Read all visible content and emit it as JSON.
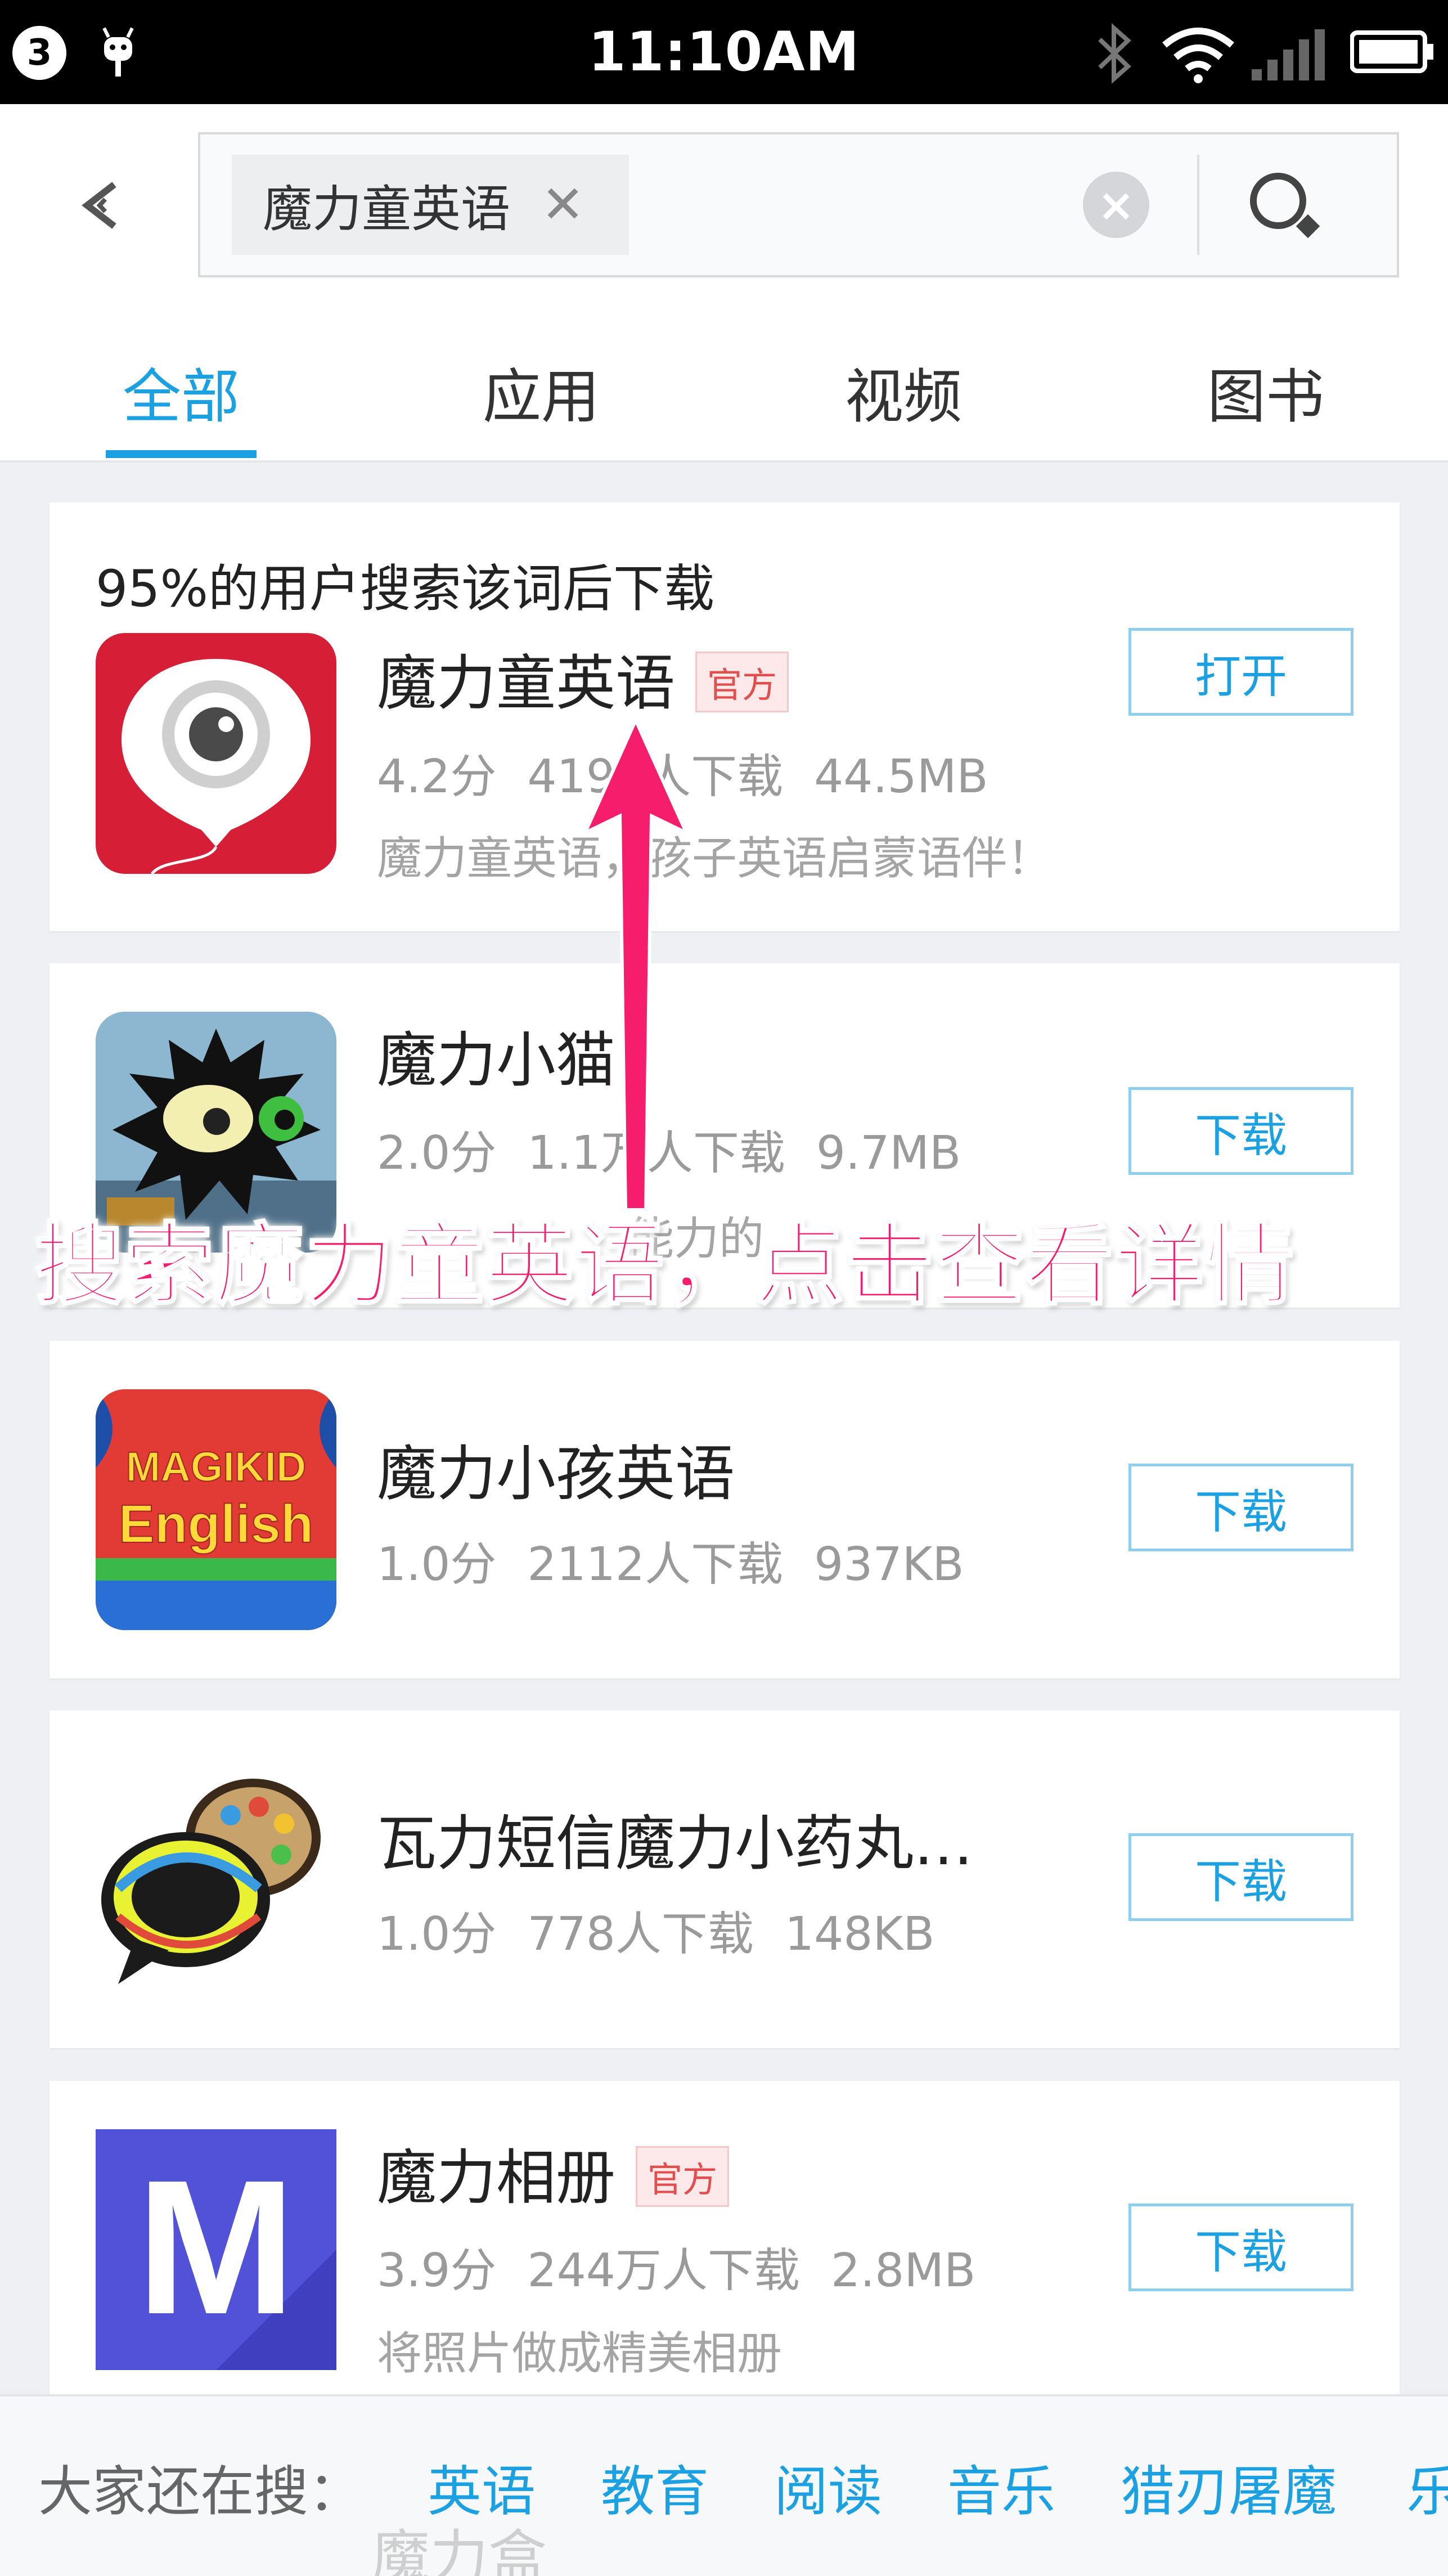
{
  "status_bar": {
    "badge_count": "3",
    "time": "11:10AM"
  },
  "search": {
    "query_chip": "魔力童英语",
    "chip_remove": "✕"
  },
  "tabs": [
    {
      "label": "全部",
      "active": true
    },
    {
      "label": "应用",
      "active": false
    },
    {
      "label": "视频",
      "active": false
    },
    {
      "label": "图书",
      "active": false
    }
  ],
  "hint": "95%的用户搜索该词后下载",
  "apps": [
    {
      "name": "魔力童英语",
      "official": true,
      "official_label": "官方",
      "rating": "4.2分",
      "downloads": "4196人下载",
      "size": "44.5MB",
      "description": "魔力童英语，孩子英语启蒙语伴！",
      "action": "打开",
      "icon": "magikid-balloon-icon"
    },
    {
      "name": "魔力小猫",
      "official": false,
      "rating": "2.0分",
      "downloads": "1.1万人下载",
      "size": "9.7MB",
      "description": "能力的",
      "action": "下载",
      "icon": "magic-cat-icon"
    },
    {
      "name": "魔力小孩英语",
      "official": false,
      "rating": "1.0分",
      "downloads": "2112人下载",
      "size": "937KB",
      "action": "下载",
      "icon_text_1": "MAGIKID",
      "icon_text_2": "English"
    },
    {
      "name": "瓦力短信魔力小药丸…",
      "official": false,
      "rating": "1.0分",
      "downloads": "778人下载",
      "size": "148KB",
      "action": "下载",
      "icon": "chat-bubble-palette-icon"
    },
    {
      "name": "魔力相册",
      "official": true,
      "official_label": "官方",
      "rating": "3.9分",
      "downloads": "244万人下载",
      "size": "2.8MB",
      "description": "将照片做成精美相册",
      "action": "下载",
      "icon_text": "M"
    }
  ],
  "partial_next_item": "魔力盒",
  "bottom_bar": {
    "label": "大家还在搜：",
    "links": [
      "英语",
      "教育",
      "阅读",
      "音乐",
      "猎刃屠魔",
      "乐"
    ]
  },
  "annotation": {
    "text": "搜索魔力童英语，点击查看详情",
    "color": "#f51d6c"
  },
  "colors": {
    "accent": "#1ba0e1",
    "official_badge": "#e24d4d"
  }
}
